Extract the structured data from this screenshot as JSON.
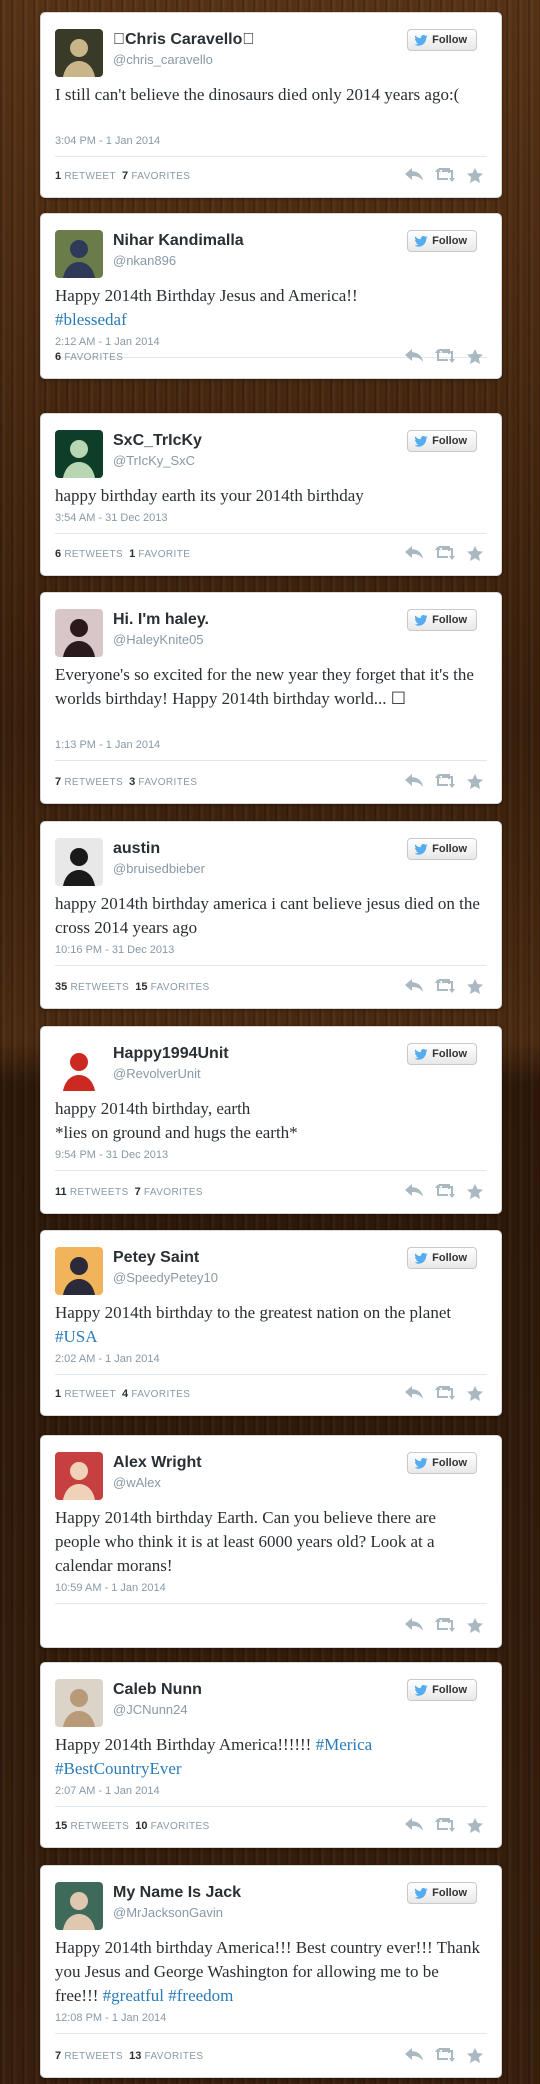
{
  "follow_label": "Follow",
  "stats_labels": {
    "retweet": "RETWEET",
    "retweets": "RETWEETS",
    "favorite": "FAVORITE",
    "favorites": "FAVORITES"
  },
  "colors": {
    "hashtag": "#2b7bb9",
    "bird": "#55acee",
    "muted": "#8899a6"
  },
  "tweets": [
    {
      "name": "\u0000Chris Caravello\u0000",
      "handle": "@chris_caravello",
      "text_parts": [
        "I still can't believe the dinosaurs died only 2014 years ago:("
      ],
      "hashtags": [],
      "timestamp": "3:04 PM - 1 Jan 2014",
      "retweets": "1",
      "retweets_label": "RETWEET",
      "favorites": "7",
      "favorites_label": "FAVORITES",
      "avatar_colors": [
        "#3a3a28",
        "#c9b58a"
      ]
    },
    {
      "name": "Nihar Kandimalla",
      "handle": "@nkan896",
      "text_parts": [
        "Happy 2014th Birthday Jesus and America!!"
      ],
      "hashtags": [
        "#blessedaf"
      ],
      "timestamp": "2:12 AM - 1 Jan 2014",
      "retweets": "",
      "retweets_label": "",
      "favorites": "6",
      "favorites_label": "FAVORITES",
      "avatar_colors": [
        "#6a7c4a",
        "#2f3a5a"
      ]
    },
    {
      "name": "SxC_TrIcKy",
      "handle": "@TrIcKy_SxC",
      "text_parts": [
        "happy birthday earth its your 2014th birthday"
      ],
      "hashtags": [],
      "timestamp": "3:54 AM - 31 Dec 2013",
      "retweets": "6",
      "retweets_label": "RETWEETS",
      "favorites": "1",
      "favorites_label": "FAVORITE",
      "avatar_colors": [
        "#0e3d2a",
        "#b8d6b2"
      ]
    },
    {
      "name": "Hi. I'm haley.",
      "handle": "@HaleyKnite05",
      "text_parts": [
        "Everyone's so excited for the new year they forget that it's the worlds birthday! Happy 2014th birthday world... ☐"
      ],
      "hashtags": [],
      "timestamp": "1:13 PM - 1 Jan 2014",
      "retweets": "7",
      "retweets_label": "RETWEETS",
      "favorites": "3",
      "favorites_label": "FAVORITES",
      "avatar_colors": [
        "#d9c6c9",
        "#2b1a1d"
      ]
    },
    {
      "name": "austin",
      "handle": "@bruisedbieber",
      "text_parts": [
        "happy 2014th birthday america i cant believe jesus died on the cross 2014 years ago"
      ],
      "hashtags": [],
      "timestamp": "10:16 PM - 31 Dec 2013",
      "retweets": "35",
      "retweets_label": "RETWEETS",
      "favorites": "15",
      "favorites_label": "FAVORITES",
      "avatar_colors": [
        "#e8e8e8",
        "#1a1a1a"
      ]
    },
    {
      "name": "Happy1994Unit",
      "handle": "@RevolverUnit",
      "text_parts": [
        "happy 2014th birthday, earth\n*lies on ground and hugs the earth*"
      ],
      "hashtags": [],
      "timestamp": "9:54 PM - 31 Dec 2013",
      "retweets": "11",
      "retweets_label": "RETWEETS",
      "favorites": "7",
      "favorites_label": "FAVORITES",
      "avatar_colors": [
        "#ffffff",
        "#cc2a20"
      ]
    },
    {
      "name": "Petey Saint",
      "handle": "@SpeedyPetey10",
      "text_parts": [
        "Happy 2014th birthday to the greatest nation on the planet "
      ],
      "hashtags": [
        "#USA"
      ],
      "timestamp": "2:02 AM - 1 Jan 2014",
      "retweets": "1",
      "retweets_label": "RETWEET",
      "favorites": "4",
      "favorites_label": "FAVORITES",
      "avatar_colors": [
        "#f2b45a",
        "#2a2a3a"
      ]
    },
    {
      "name": "Alex Wright",
      "handle": "@wAlex",
      "text_parts": [
        "Happy 2014th birthday Earth. Can you believe there are people who think it is at least 6000 years old? Look at a calendar morans!"
      ],
      "hashtags": [],
      "timestamp": "10:59 AM - 1 Jan 2014",
      "retweets": "",
      "retweets_label": "",
      "favorites": "",
      "favorites_label": "",
      "avatar_colors": [
        "#c74040",
        "#f0d2b8"
      ]
    },
    {
      "name": "Caleb Nunn",
      "handle": "@JCNunn24",
      "text_parts": [
        "Happy 2014th Birthday America!!!!!! "
      ],
      "hashtags": [
        "#Merica",
        "#BestCountryEver"
      ],
      "timestamp": "2:07 AM - 1 Jan 2014",
      "retweets": "15",
      "retweets_label": "RETWEETS",
      "favorites": "10",
      "favorites_label": "FAVORITES",
      "avatar_colors": [
        "#dcd4c8",
        "#b89a78"
      ]
    },
    {
      "name": "My Name Is Jack",
      "handle": "@MrJacksonGavin",
      "text_parts": [
        "Happy 2014th birthday America!!! Best country ever!!! Thank you Jesus and George Washington for allowing me to be free!!! "
      ],
      "hashtags": [
        "#greatful",
        "#freedom"
      ],
      "timestamp": "12:08 PM - 1 Jan 2014",
      "retweets": "7",
      "retweets_label": "RETWEETS",
      "favorites": "13",
      "favorites_label": "FAVORITES",
      "avatar_colors": [
        "#3f6a5a",
        "#e0c8b0"
      ]
    }
  ]
}
